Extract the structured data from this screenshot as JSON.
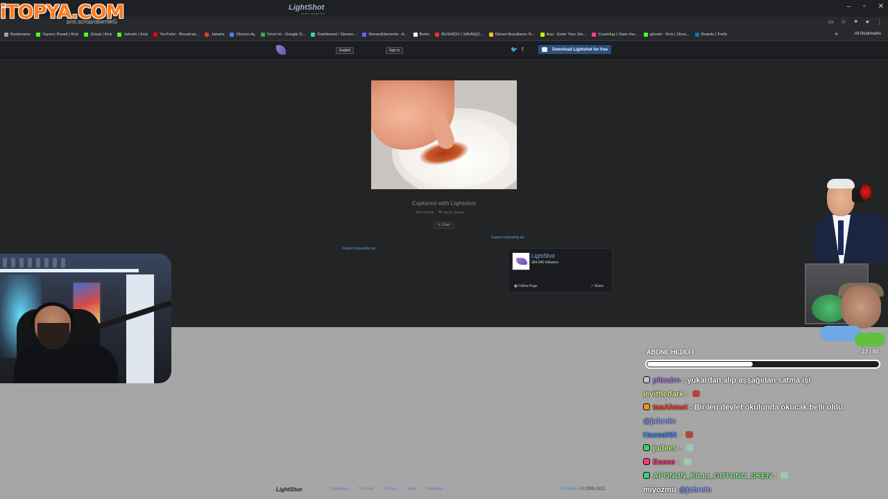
{
  "brand": {
    "logo_text": "iTOPYA.COM"
  },
  "browser": {
    "url": "prnt.sc/rsp/oberr6kG",
    "window_controls": [
      "–",
      "▫",
      "✕"
    ],
    "bookmarks": [
      {
        "label": "Bookmarks",
        "color": "#9aa0a6"
      },
      {
        "label": "Yayıncı Paneli | Kick",
        "color": "#53fc18"
      },
      {
        "label": "Gözat | Kick",
        "color": "#53fc18"
      },
      {
        "label": "Jahrein | Kick",
        "color": "#53fc18"
      },
      {
        "label": "YouTube - Broadcas...",
        "color": "#ff0000"
      },
      {
        "label": "Jaharia",
        "color": "#e53935"
      },
      {
        "label": "Oturum Aç",
        "color": "#4285f4"
      },
      {
        "label": "Drive'ım - Google D...",
        "color": "#34a853"
      },
      {
        "label": "Dashboard / Stream...",
        "color": "#2dd4bf"
      },
      {
        "label": "StreamElements - A...",
        "color": "#6c63ff"
      },
      {
        "label": "Botrix",
        "color": "#ffffff"
      },
      {
        "label": "BUSHIDO | SAVAŞÇI...",
        "color": "#e53935"
      },
      {
        "label": "Görsel Boyutlarını N...",
        "color": "#fbc02d"
      },
      {
        "label": "ikas - Enter Your Sto...",
        "color": "#c6ff00"
      },
      {
        "label": "CaseHug | Open the...",
        "color": "#ff4081"
      },
      {
        "label": "jahrein - Kick | Strea...",
        "color": "#53fc18"
      },
      {
        "label": "Boards | Trello",
        "color": "#0079bf"
      }
    ],
    "bookmarks_more": "»",
    "all_bookmarks": "All Bookmarks"
  },
  "lightshot": {
    "logo": "LightShot",
    "tagline": "screen capture tool",
    "language": "English",
    "sign_in": "Sign in",
    "download_label": "Download Lightshot for free",
    "caption": "Captured with Lightshot",
    "find_similar": "find similar",
    "report_abuse": "report abuse",
    "post_label": "Post",
    "report_ad_left": "Report misleading ad",
    "report_ad_right": "Report misleading ad",
    "fb": {
      "name": "LightShot",
      "followers": "384,046 followers",
      "follow": "Follow Page",
      "share": "Share"
    },
    "footer": {
      "logo": "LightShot",
      "links": [
        "Download",
        "Tutorials",
        "Privacy",
        "Help",
        "Advertise"
      ],
      "copy_prefix": "Skillbrains",
      "copy": "© 2009-2022"
    }
  },
  "goal": {
    "label": "ABONE HEDEFİ",
    "count": "23 / 50",
    "fill_fraction": 0.46
  },
  "chat": [
    {
      "user": "pitcairn",
      "user_color": "#b07be8",
      "badge": "#c0c0c0",
      "text": "yukardan alıp aşşağıdan satma işi",
      "emote": ""
    },
    {
      "user": "levithedark",
      "user_color": "#e6f58f",
      "badge": "",
      "text": "",
      "emote": "#b5463a"
    },
    {
      "user": "taeAhmet",
      "user_color": "#ff4d2d",
      "badge": "#f09020",
      "text": "Birileri devlet okulunda okucak belli oldu",
      "emote": ""
    },
    {
      "user": "",
      "user_color": "#8fa6ff",
      "badge": "",
      "text": "@jahrein",
      "emote": ""
    },
    {
      "user": "HaceaNN",
      "user_color": "#4a8fff",
      "badge": "",
      "text": "",
      "emote": "#b5463a"
    },
    {
      "user": "judees",
      "user_color": "#b8ff7a",
      "badge": "#3cd070",
      "text": "",
      "emote": "#9fc7b0"
    },
    {
      "user": "Eeeee",
      "user_color": "#ff3a7a",
      "badge": "#ff3a7a",
      "text": "",
      "emote": "#9fc7b0"
    },
    {
      "user": "APONUN_KILLI_GOTUNU_SKEN",
      "user_color": "#8ff08f",
      "badge": "#3cd070",
      "text": "",
      "emote": "#9fc7b0"
    },
    {
      "user": "",
      "user_color": "#ffffff",
      "badge": "",
      "text": "miyozmu",
      "mention": "@jahrein",
      "emote": ""
    }
  ]
}
